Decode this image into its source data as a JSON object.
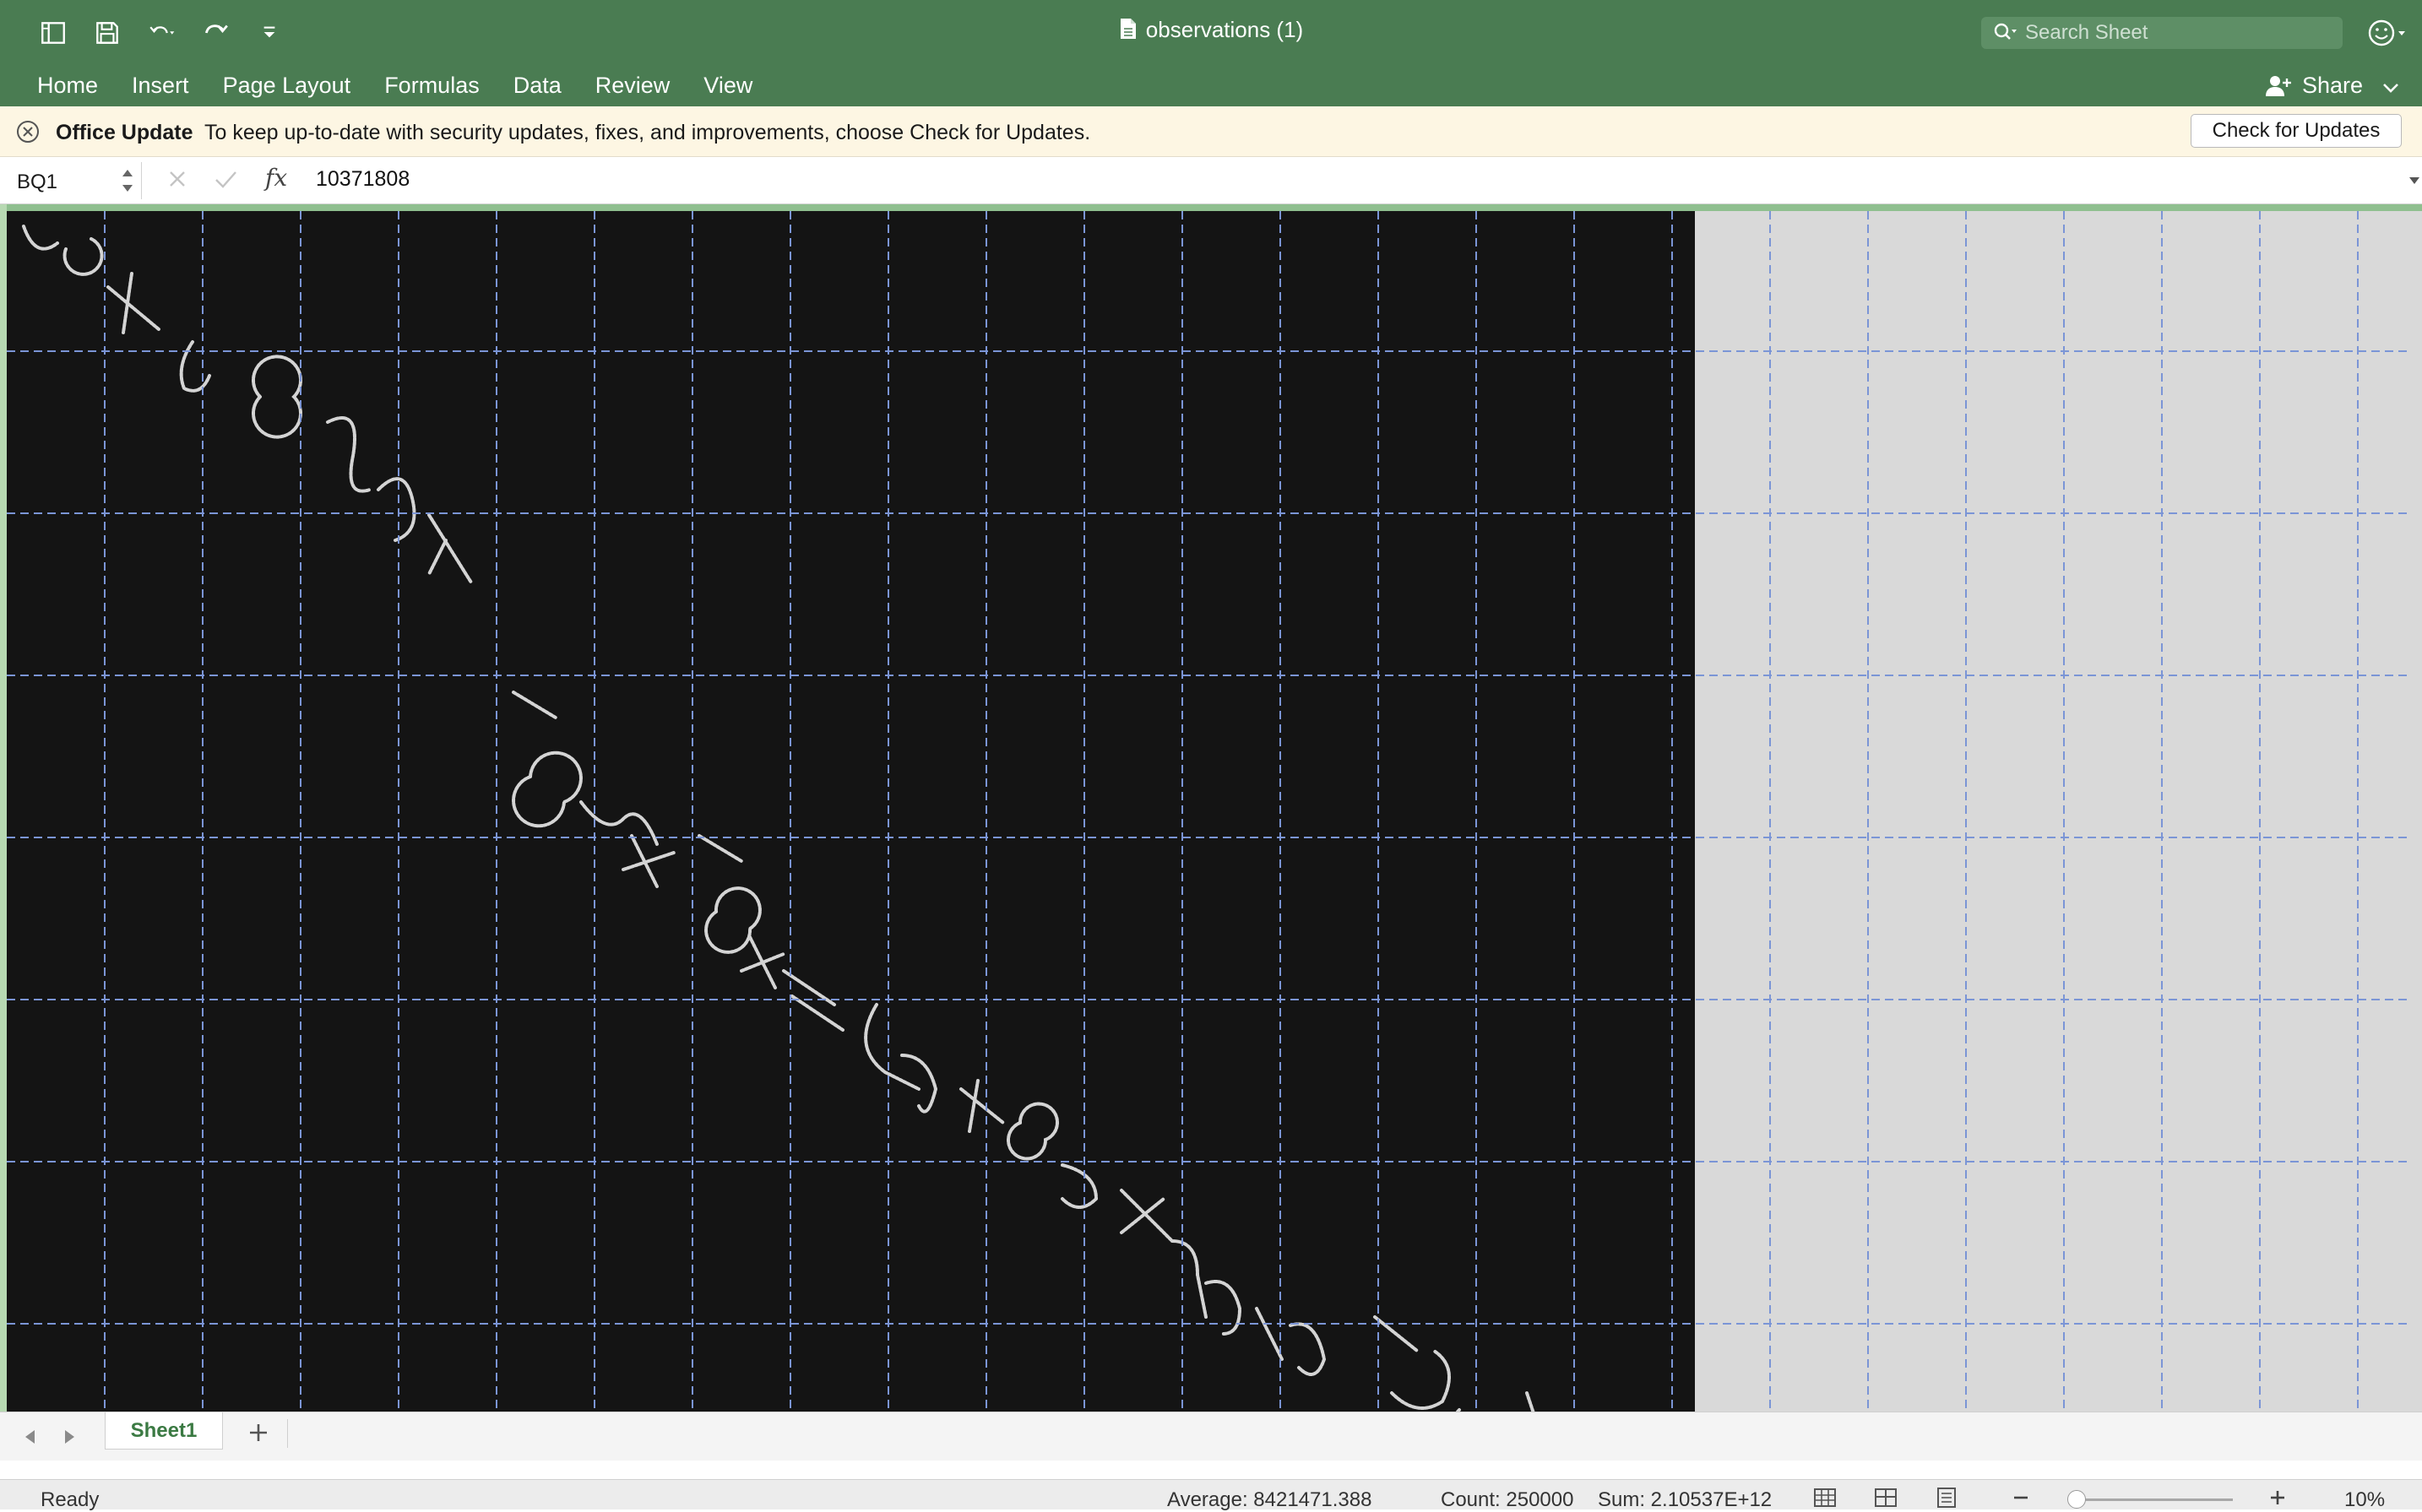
{
  "window": {
    "title": "observations (1)"
  },
  "quick_access": {
    "icons": [
      "sidebar-icon",
      "save-icon",
      "undo-icon",
      "redo-icon",
      "customize-icon"
    ]
  },
  "search": {
    "placeholder": "Search Sheet"
  },
  "ribbon": {
    "tabs": [
      "Home",
      "Insert",
      "Page Layout",
      "Formulas",
      "Data",
      "Review",
      "View"
    ],
    "share_label": "Share"
  },
  "message_bar": {
    "title": "Office Update",
    "text": "To keep up-to-date with security updates, fixes, and improvements, choose Check for Updates.",
    "button_label": "Check for Updates"
  },
  "formula_bar": {
    "name_box": "BQ1",
    "fx_label": "fx",
    "value": "10371808"
  },
  "grid": {
    "picture_content": "dark pixel image containing a diagonal run of handwritten-looking characters"
  },
  "sheets": {
    "tabs": [
      "Sheet1"
    ],
    "active": "Sheet1"
  },
  "status_bar": {
    "mode": "Ready",
    "average": "Average: 8421471.388",
    "count": "Count: 250000",
    "sum": "Sum: 2.10537E+12",
    "zoom": "10%"
  },
  "colors": {
    "ribbon_green": "#4a7c52",
    "message_bar": "#fdf6e3",
    "picture_background": "#141414",
    "sheet_tab_text": "#3b7a43",
    "page_break_lines": "#7b95d6"
  }
}
